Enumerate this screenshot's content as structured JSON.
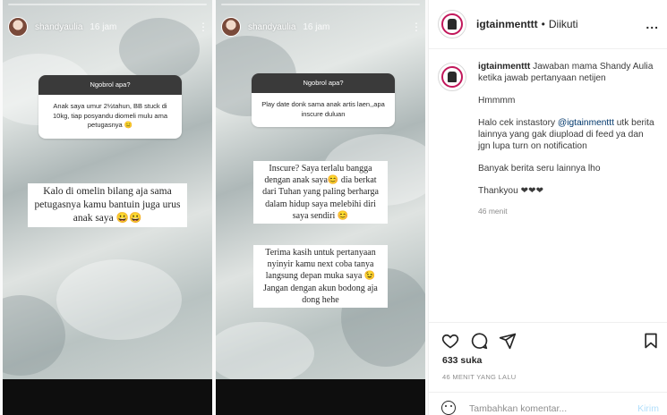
{
  "stories": [
    {
      "username": "shandyaulia",
      "time": "16 jam",
      "question_header": "Ngobrol apa?",
      "question_text": "Anak saya umur 2½tahun, BB stuck di 10kg, tiap posyandu diomeli mulu ama petugasnya 😑",
      "answers": [
        "Kalo di omelin bilang aja sama petugasnya kamu bantuin juga urus anak saya 😀😀"
      ]
    },
    {
      "username": "shandyaulia",
      "time": "16 jam",
      "question_header": "Ngobrol apa?",
      "question_text": "Play date donk sama anak artis laen,,apa inscure duluan",
      "answers": [
        "Inscure? Saya terlalu bangga dengan anak saya😊 dia berkat dari Tuhan yang paling berharga dalam hidup saya melebihi diri saya sendiri 😊",
        "Terima kasih untuk pertanyaan nyinyir kamu next coba tanya langsung depan muka saya 😉 Jangan dengan akun bodong aja dong hehe"
      ]
    }
  ],
  "sidebar": {
    "header": {
      "username": "igtainmenttt",
      "separator": "•",
      "follow_status": "Diikuti",
      "more_label": "..."
    },
    "caption": {
      "username": "igtainmenttt",
      "first_line": "Jawaban mama Shandy Aulia ketika jawab pertanyaan netijen",
      "line_hmm": "Hmmmm",
      "promo_before": "Halo cek instastory ",
      "promo_mention": "@igtainmenttt",
      "promo_after": " utk berita lainnya yang gak diupload di feed ya dan jgn lupa turn on notification",
      "line_more": "Banyak berita seru lainnya lho",
      "line_thanks": "Thankyou ❤❤❤",
      "time": "46 menit"
    },
    "likes": "633 suka",
    "posted_ago": "46 MENIT YANG LALU",
    "comment_input": {
      "placeholder": "Tambahkan komentar...",
      "send_label": "Kirim"
    }
  },
  "icons": [
    "heart-icon",
    "comment-icon",
    "share-icon",
    "bookmark-icon",
    "emoji-icon",
    "more-icon"
  ],
  "colors": {
    "mention": "#00376b",
    "send_disabled": "#b2dffc",
    "text": "#262626",
    "muted": "#8e8e8e"
  }
}
